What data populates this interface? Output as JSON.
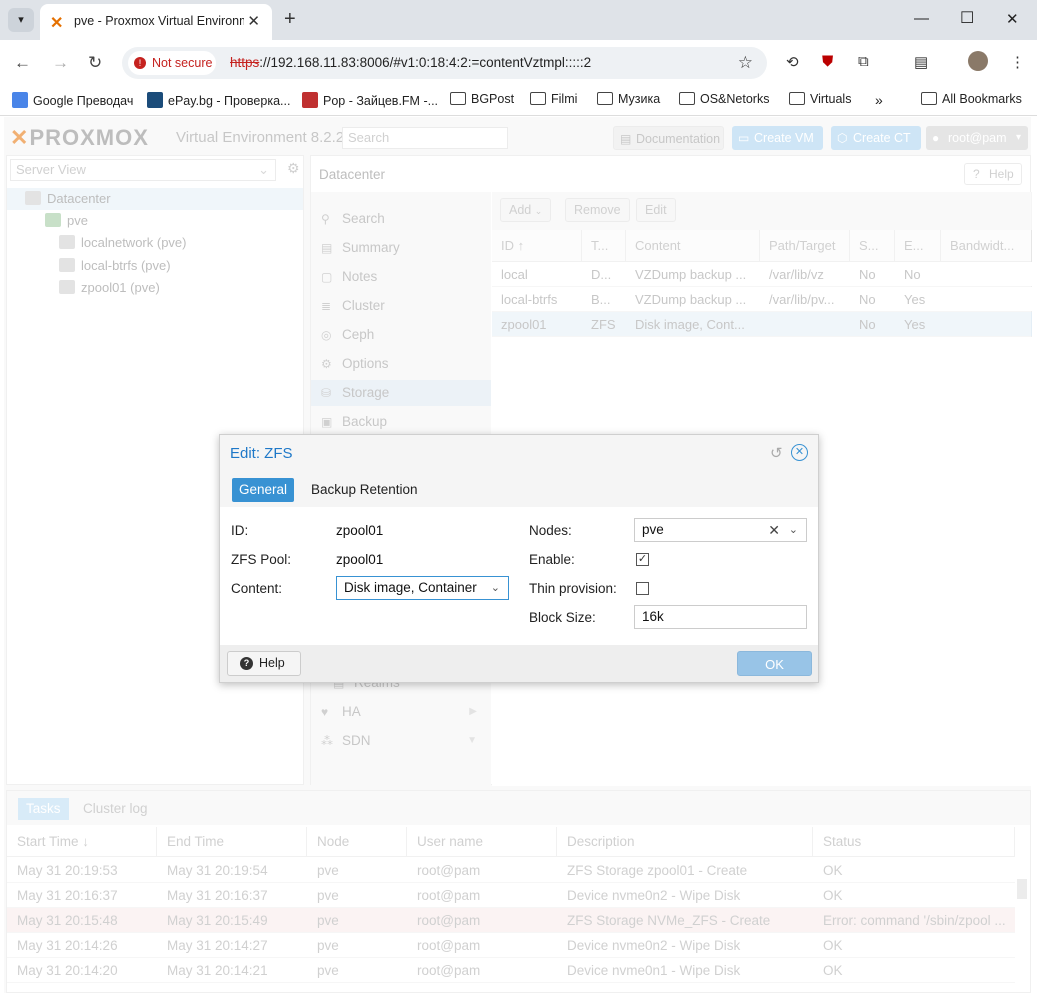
{
  "browser": {
    "tab_title": "pve - Proxmox Virtual Environment",
    "not_secure": "Not secure",
    "url_scheme": "https",
    "url_rest": "://192.168.11.83:8006/#v1:0:18:4:2:=contentVztmpl:::::2",
    "bookmarks": [
      "Google Преводач",
      "ePay.bg - Проверка...",
      "Pop - Зайцев.FM -...",
      "BGPost",
      "Filmi",
      "Музика",
      "OS&Netorks",
      "Virtuals"
    ],
    "all_bookmarks": "All Bookmarks"
  },
  "header": {
    "logo": "PROXMOX",
    "product": "Virtual Environment 8.2.2",
    "search_placeholder": "Search",
    "documentation": "Documentation",
    "create_vm": "Create VM",
    "create_ct": "Create CT",
    "user": "root@pam"
  },
  "tree": {
    "view": "Server View",
    "datacenter": "Datacenter",
    "node": "pve",
    "items": [
      "localnetwork (pve)",
      "local-btrfs (pve)",
      "zpool01 (pve)"
    ]
  },
  "datacenter": {
    "title": "Datacenter",
    "help": "Help",
    "nav": [
      "Search",
      "Summary",
      "Notes",
      "Cluster",
      "Ceph",
      "Options",
      "Storage",
      "Backup",
      "Realms",
      "HA",
      "SDN"
    ],
    "toolbar": {
      "add": "Add",
      "remove": "Remove",
      "edit": "Edit"
    },
    "columns": [
      "ID ↑",
      "T...",
      "Content",
      "Path/Target",
      "S...",
      "E...",
      "Bandwidt..."
    ],
    "rows": [
      [
        "local",
        "D...",
        "VZDump backup ...",
        "/var/lib/vz",
        "No",
        "No"
      ],
      [
        "local-btrfs",
        "B...",
        "VZDump backup ...",
        "/var/lib/pv...",
        "No",
        "Yes"
      ],
      [
        "zpool01",
        "ZFS",
        "Disk image, Cont...",
        "",
        "No",
        "Yes"
      ]
    ]
  },
  "tasks": {
    "tabs": [
      "Tasks",
      "Cluster log"
    ],
    "columns": [
      "Start Time ↓",
      "End Time",
      "Node",
      "User name",
      "Description",
      "Status"
    ],
    "rows": [
      [
        "May 31 20:19:53",
        "May 31 20:19:54",
        "pve",
        "root@pam",
        "ZFS Storage zpool01 - Create",
        "OK"
      ],
      [
        "May 31 20:16:37",
        "May 31 20:16:37",
        "pve",
        "root@pam",
        "Device nvme0n2 - Wipe Disk",
        "OK"
      ],
      [
        "May 31 20:15:48",
        "May 31 20:15:49",
        "pve",
        "root@pam",
        "ZFS Storage NVMe_ZFS - Create",
        "Error: command '/sbin/zpool ..."
      ],
      [
        "May 31 20:14:26",
        "May 31 20:14:27",
        "pve",
        "root@pam",
        "Device nvme0n2 - Wipe Disk",
        "OK"
      ],
      [
        "May 31 20:14:20",
        "May 31 20:14:21",
        "pve",
        "root@pam",
        "Device nvme0n1 - Wipe Disk",
        "OK"
      ]
    ]
  },
  "dialog": {
    "title": "Edit: ZFS",
    "tabs": [
      "General",
      "Backup Retention"
    ],
    "id_label": "ID:",
    "id_value": "zpool01",
    "pool_label": "ZFS Pool:",
    "pool_value": "zpool01",
    "content_label": "Content:",
    "content_value": "Disk image, Container",
    "nodes_label": "Nodes:",
    "nodes_value": "pve",
    "enable_label": "Enable:",
    "enable_checked": true,
    "thin_label": "Thin provision:",
    "thin_checked": false,
    "blocksize_label": "Block Size:",
    "blocksize_value": "16k",
    "help": "Help",
    "ok": "OK"
  },
  "colors": {
    "accent": "#3892d3",
    "title_blue": "#1e78c8",
    "brand_orange": "#e57000"
  }
}
